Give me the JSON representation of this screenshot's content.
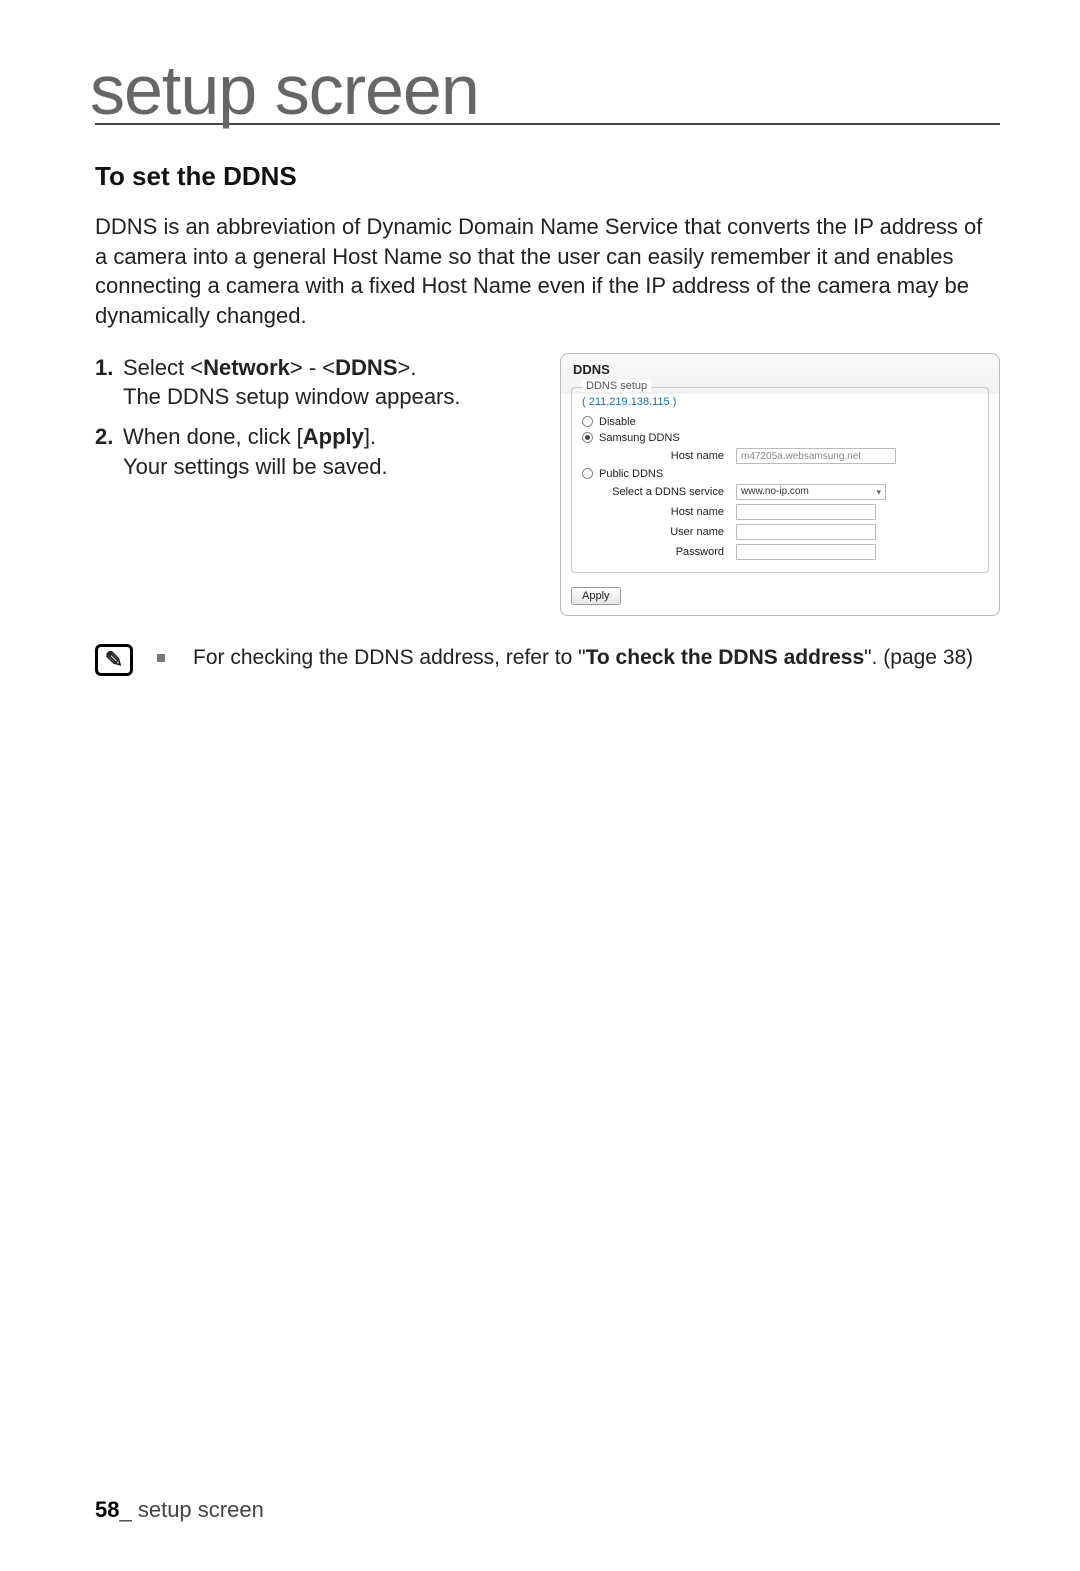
{
  "page": {
    "header_title": "setup screen",
    "subheading": "To set the DDNS",
    "intro": "DDNS is an abbreviation of Dynamic Domain Name Service that converts the IP address of a camera into a general Host Name so that the user can easily remember it and enables connecting a camera with a fixed Host Name even if the IP address of the camera may be dynamically changed.",
    "note_prefix": "For checking the DDNS address, refer to \"",
    "note_bold": "To check the DDNS address",
    "note_suffix": "\". (page 38)",
    "note_icon_glyph": "✎",
    "footer_page": "58",
    "footer_sep": "_ ",
    "footer_label": "setup screen"
  },
  "steps": [
    {
      "num": "1.",
      "pre": " Select <",
      "b1": "Network",
      "mid": "> - <",
      "b2": "DDNS",
      "post": ">.",
      "line2": "The DDNS setup window appears."
    },
    {
      "num": "2.",
      "pre": " When done, click [",
      "b1": "Apply",
      "mid": "",
      "b2": "",
      "post": "].",
      "line2": "Your settings will be saved."
    }
  ],
  "panel": {
    "title": "DDNS",
    "legend": "DDNS setup",
    "ip": "( 211.219.138.115 )",
    "opt_disable": "Disable",
    "opt_samsung": "Samsung DDNS",
    "samsung_hostname_label": "Host name",
    "samsung_hostname_value": "m47205a.websamsung.net",
    "opt_public": "Public DDNS",
    "public_service_label": "Select a DDNS service",
    "public_service_value": "www.no-ip.com",
    "public_hostname_label": "Host name",
    "public_username_label": "User name",
    "public_password_label": "Password",
    "apply_label": "Apply"
  }
}
